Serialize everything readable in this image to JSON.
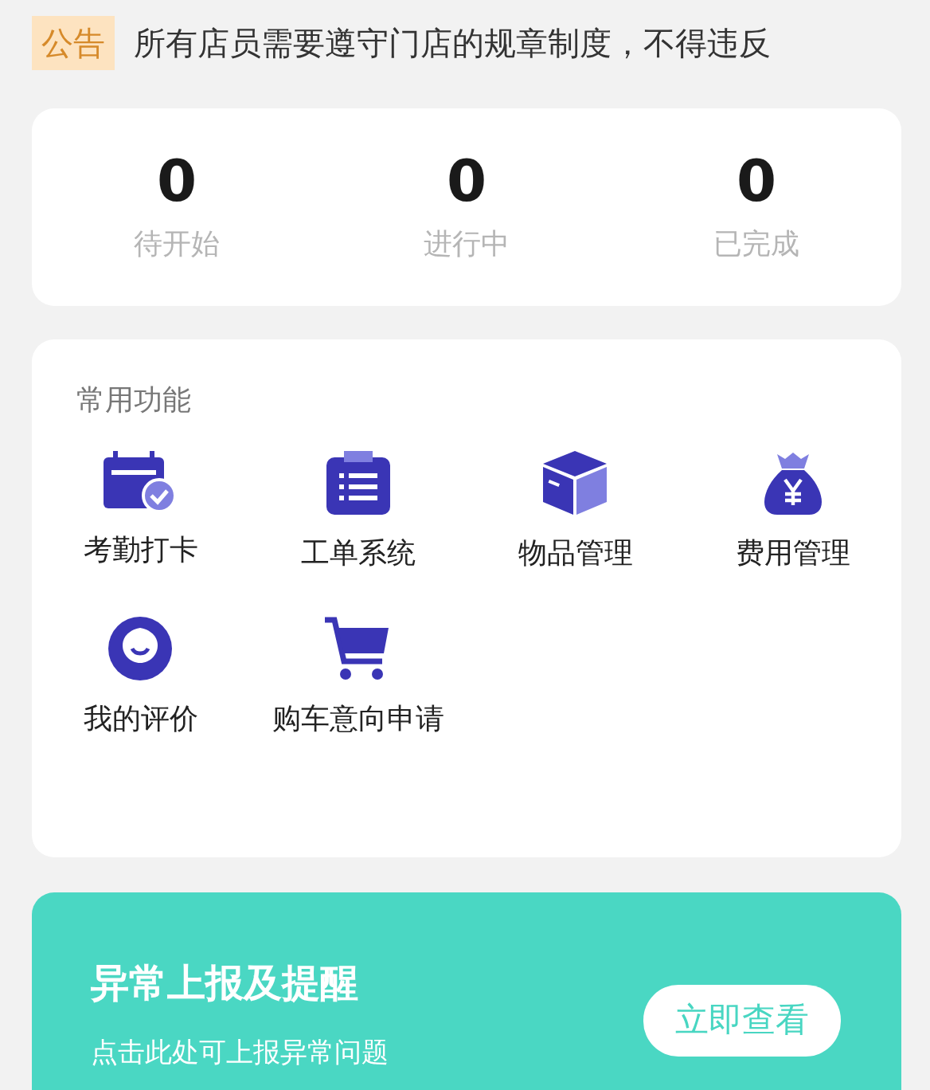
{
  "notice": {
    "tag": "公告",
    "text": "所有店员需要遵守门店的规章制度，不得违反"
  },
  "stats": [
    {
      "value": "0",
      "label": "待开始"
    },
    {
      "value": "0",
      "label": "进行中"
    },
    {
      "value": "0",
      "label": "已完成"
    }
  ],
  "functions": {
    "title": "常用功能",
    "items": [
      {
        "label": "考勤打卡"
      },
      {
        "label": "工单系统"
      },
      {
        "label": "物品管理"
      },
      {
        "label": "费用管理"
      },
      {
        "label": "我的评价"
      },
      {
        "label": "购车意向申请"
      }
    ]
  },
  "banner": {
    "title": "异常上报及提醒",
    "subtitle": "点击此处可上报异常问题",
    "button": "立即查看"
  }
}
